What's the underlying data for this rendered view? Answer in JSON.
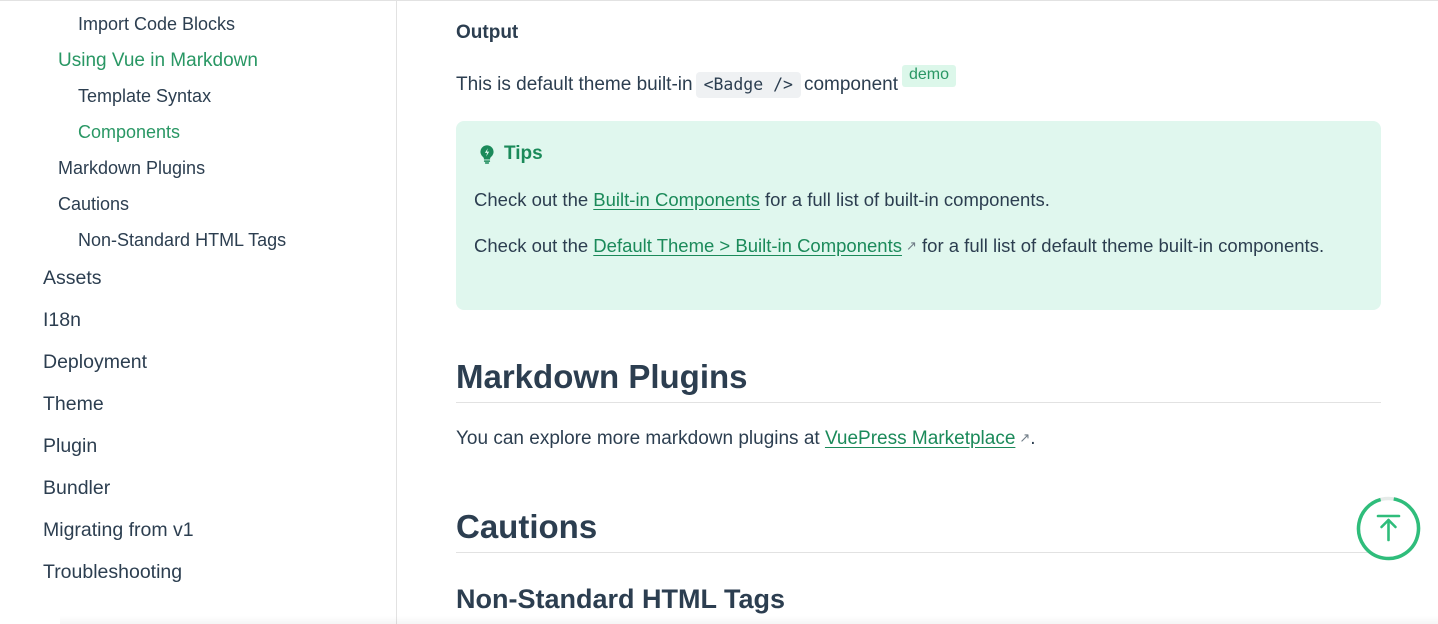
{
  "sidebar": {
    "items": [
      {
        "label": "Import Code Blocks",
        "level": 3,
        "active": false
      },
      {
        "label": "Using Vue in Markdown",
        "level": 2,
        "active": true
      },
      {
        "label": "Template Syntax",
        "level": 3,
        "active": false
      },
      {
        "label": "Components",
        "level": 3,
        "active": true
      },
      {
        "label": "Markdown Plugins",
        "level": 2,
        "active": false
      },
      {
        "label": "Cautions",
        "level": 2,
        "active": false
      },
      {
        "label": "Non-Standard HTML Tags",
        "level": 3,
        "active": false
      },
      {
        "label": "Assets",
        "level": 1,
        "active": false
      },
      {
        "label": "I18n",
        "level": 1,
        "active": false
      },
      {
        "label": "Deployment",
        "level": 1,
        "active": false
      },
      {
        "label": "Theme",
        "level": 1,
        "active": false
      },
      {
        "label": "Plugin",
        "level": 1,
        "active": false
      },
      {
        "label": "Bundler",
        "level": 1,
        "active": false
      },
      {
        "label": "Migrating from v1",
        "level": 1,
        "active": false
      },
      {
        "label": "Troubleshooting",
        "level": 1,
        "active": false
      }
    ]
  },
  "content": {
    "output_heading": "Output",
    "output_text_before": "This is default theme built-in",
    "output_code": "<Badge />",
    "output_text_after": "component",
    "badge_text": "demo",
    "tip": {
      "title": "Tips",
      "p1_before": "Check out the",
      "p1_link": "Built-in Components",
      "p1_after": "for a full list of built-in components.",
      "p2_before": "Check out the",
      "p2_link": "Default Theme > Built-in Components",
      "p2_after": "for a full list of default theme built-in components."
    },
    "markdown_plugins_heading": "Markdown Plugins",
    "markdown_plugins_before": "You can explore more markdown plugins at",
    "markdown_plugins_link": "VuePress Marketplace",
    "markdown_plugins_after": ".",
    "cautions_heading": "Cautions",
    "non_standard_heading": "Non-Standard HTML Tags",
    "external_icon": "external-link-icon"
  },
  "colors": {
    "accent": "#299764",
    "tip_bg": "#e0f7ee",
    "tip_title": "#1b8a5a",
    "text": "#2c3e50",
    "border": "#e2e2e2"
  },
  "icons": {
    "tip": "lightbulb-icon",
    "back_to_top": "arrow-up-icon"
  }
}
